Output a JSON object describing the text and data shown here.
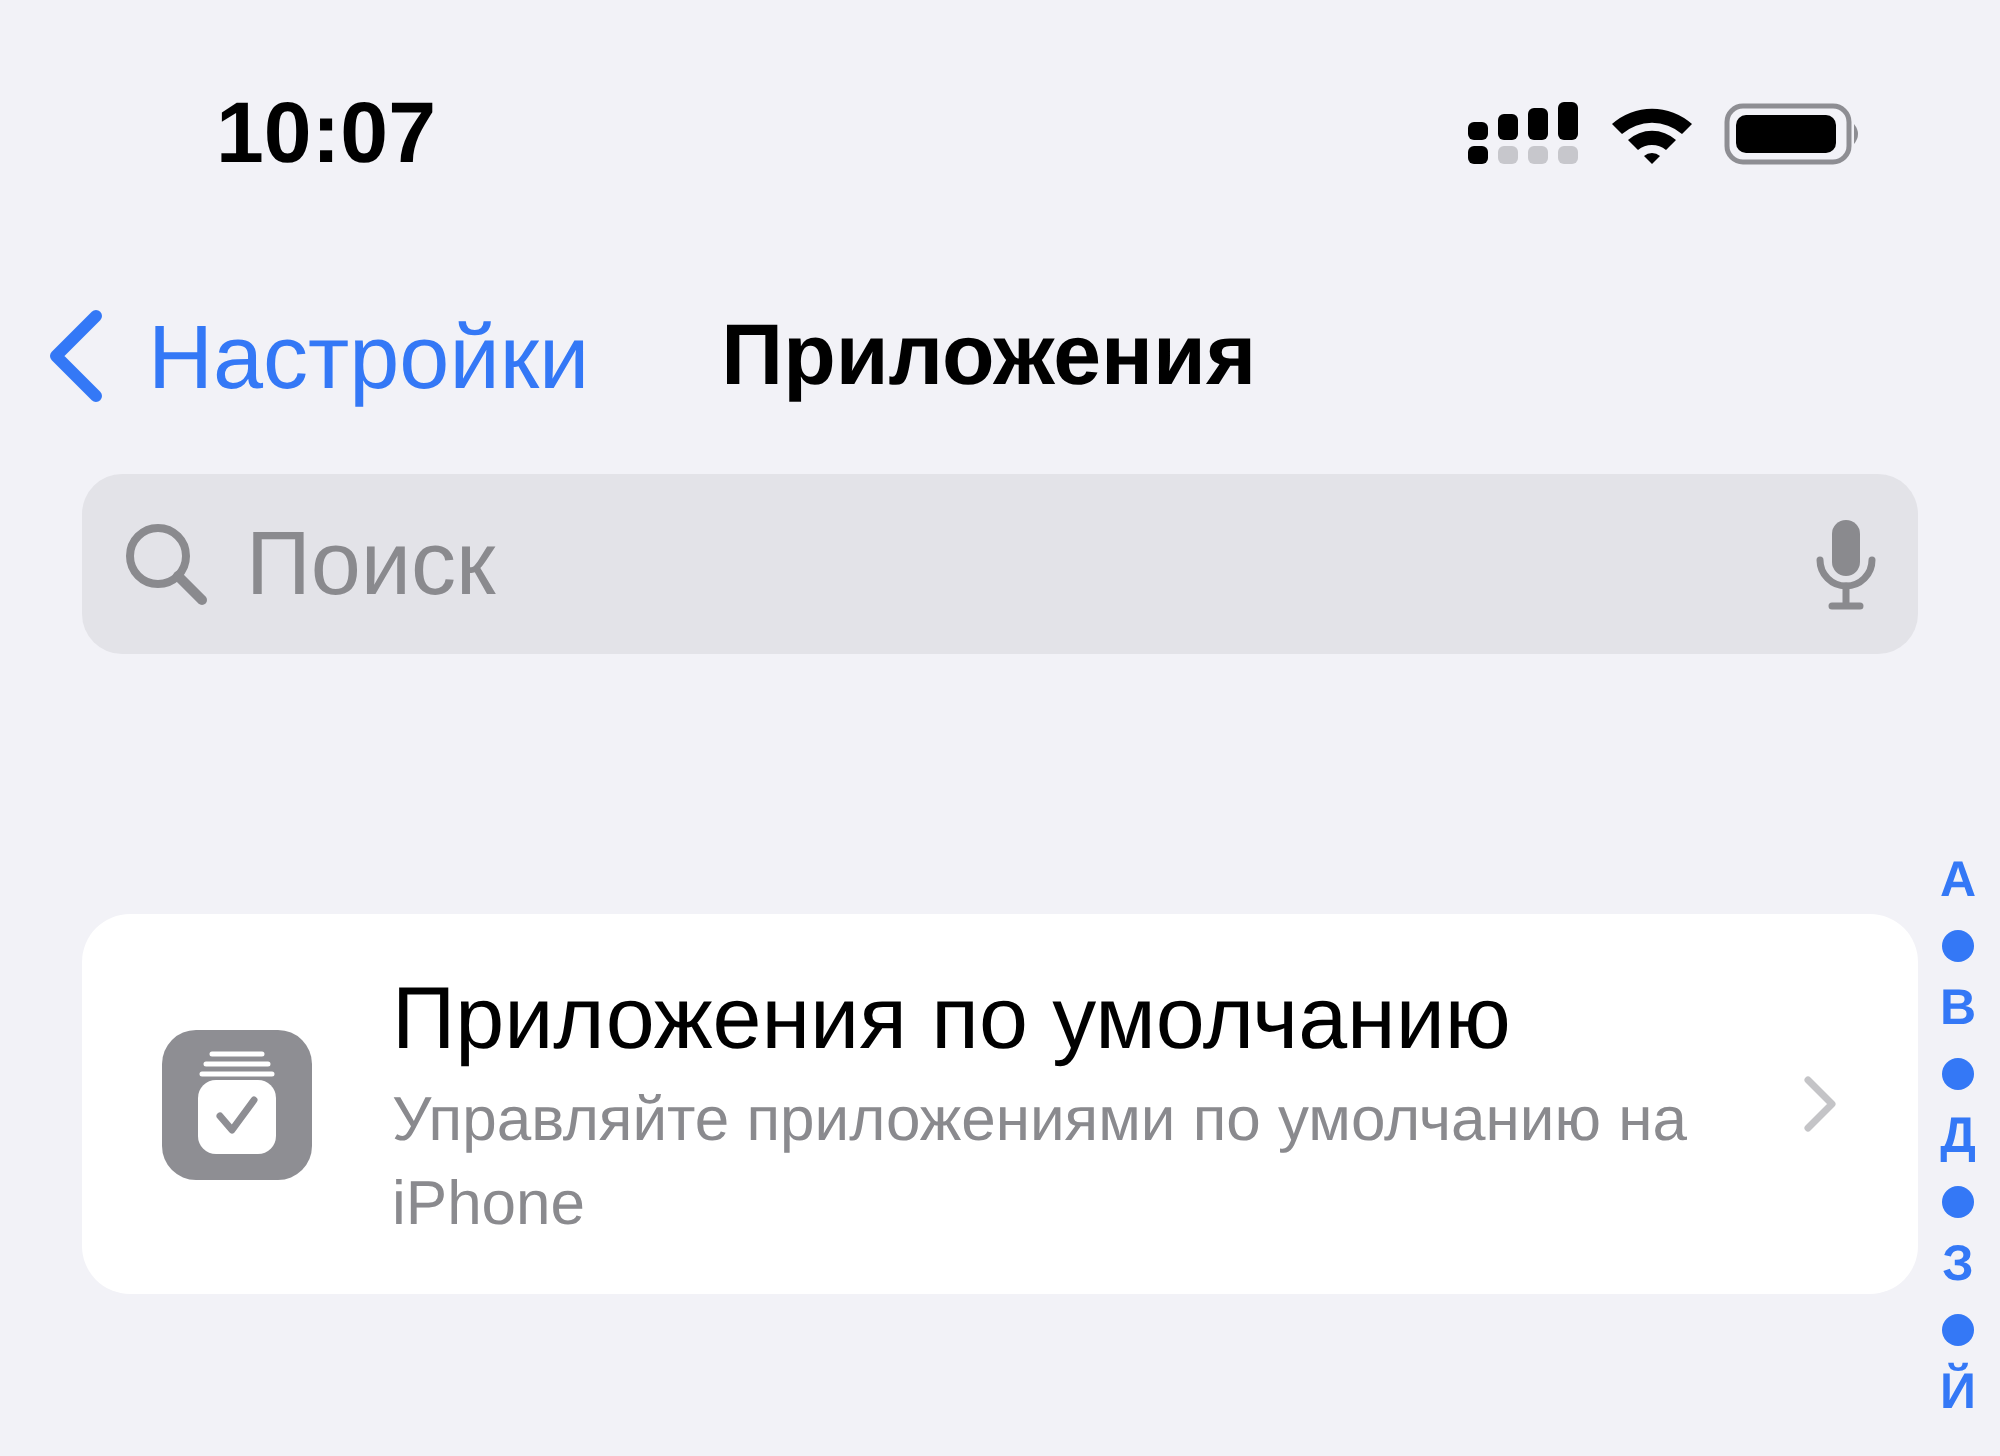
{
  "status_bar": {
    "time": "10:07"
  },
  "nav": {
    "back": "Настройки",
    "title": "Приложения"
  },
  "search": {
    "placeholder": "Поиск"
  },
  "list": [
    {
      "title": "Приложения по умолчанию",
      "subtitle": "Управляйте приложениями по умолчанию на iPhone"
    }
  ],
  "index": [
    {
      "kind": "letter",
      "text": "А"
    },
    {
      "kind": "dot"
    },
    {
      "kind": "letter",
      "text": "В"
    },
    {
      "kind": "dot"
    },
    {
      "kind": "letter",
      "text": "Д"
    },
    {
      "kind": "dot"
    },
    {
      "kind": "letter",
      "text": "З"
    },
    {
      "kind": "dot"
    },
    {
      "kind": "letter",
      "text": "Й"
    }
  ]
}
